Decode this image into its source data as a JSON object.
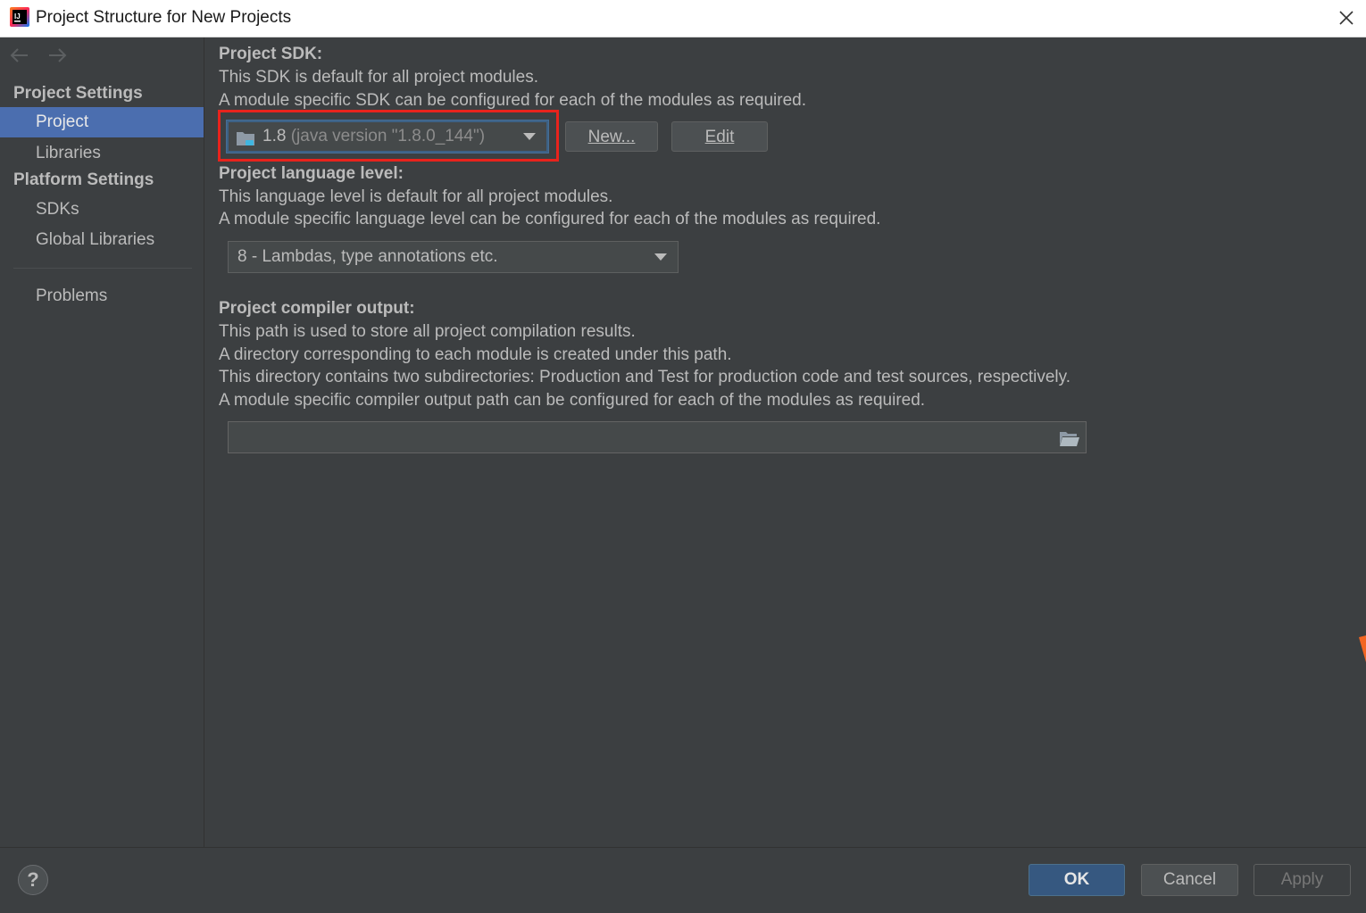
{
  "window": {
    "title": "Project Structure for New Projects",
    "app_icon": "intellij-idea-icon",
    "close_icon": "close-icon"
  },
  "sidebar": {
    "back_icon": "arrow-left-icon",
    "forward_icon": "arrow-right-icon",
    "project_settings_header": "Project Settings",
    "project_settings_items": [
      {
        "label": "Project",
        "selected": true
      },
      {
        "label": "Libraries",
        "selected": false
      }
    ],
    "platform_settings_header": "Platform Settings",
    "platform_settings_items": [
      {
        "label": "SDKs"
      },
      {
        "label": "Global Libraries"
      }
    ],
    "problems_label": "Problems"
  },
  "content": {
    "sdk": {
      "heading": "Project SDK:",
      "desc_line1": "This SDK is default for all project modules.",
      "desc_line2": "A module specific SDK can be configured for each of the modules as required.",
      "selected_name": "1.8",
      "selected_version": "(java version \"1.8.0_144\")",
      "new_button": "New...",
      "edit_button": "Edit"
    },
    "language_level": {
      "heading": "Project language level:",
      "desc_line1": "This language level is default for all project modules.",
      "desc_line2": "A module specific language level can be configured for each of the modules as required.",
      "selected": "8 - Lambdas, type annotations etc."
    },
    "compiler_output": {
      "heading": "Project compiler output:",
      "desc_line1": "This path is used to store all project compilation results.",
      "desc_line2": "A directory corresponding to each module is created under this path.",
      "desc_line3": "This directory contains two subdirectories: Production and Test for production code and test sources, respectively.",
      "desc_line4": "A module specific compiler output path can be configured for each of the modules as required.",
      "path_value": ""
    }
  },
  "footer": {
    "help_label": "?",
    "ok_label": "OK",
    "cancel_label": "Cancel",
    "apply_label": "Apply"
  },
  "colors": {
    "background": "#3c3f41",
    "selection": "#4b6eaf",
    "highlight_annotation": "#e8231c",
    "ok_button": "#365880"
  }
}
